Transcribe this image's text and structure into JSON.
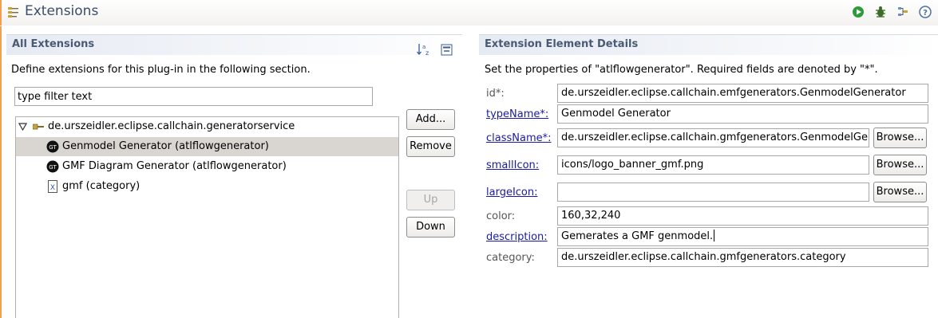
{
  "header": {
    "title": "Extensions",
    "icons": [
      "extensions-icon",
      "run-icon",
      "debug-icon",
      "extension-wizard-icon",
      "help-icon"
    ]
  },
  "left": {
    "title": "All Extensions",
    "description": "Define extensions for this plug-in in the following section.",
    "filter_placeholder": "type filter text",
    "tree": {
      "root": "de.urszeidler.eclipse.callchain.generatorservice",
      "children": [
        {
          "label": "Genmodel Generator (atlflowgenerator)",
          "icon": "generator-icon",
          "selected": true
        },
        {
          "label": "GMF Diagram Generator (atlflowgenerator)",
          "icon": "generator-icon",
          "selected": false
        },
        {
          "label": "gmf (category)",
          "icon": "category-icon",
          "selected": false
        }
      ]
    },
    "buttons": {
      "add": "Add...",
      "remove": "Remove",
      "up": "Up",
      "down": "Down"
    }
  },
  "right": {
    "title": "Extension Element Details",
    "description": "Set the properties of \"atlflowgenerator\". Required fields are denoted by \"*\".",
    "browse_label": "Browse...",
    "fields": {
      "id": {
        "label": "id*:",
        "value": "de.urszeidler.eclipse.callchain.emfgenerators.GenmodelGenerator"
      },
      "typeName": {
        "label": "typeName*:",
        "value": "Genmodel Generator"
      },
      "className": {
        "label": "className*:",
        "value": "de.urszeidler.eclipse.callchain.gmfgenerators.GenmodelGenerator"
      },
      "smallIcon": {
        "label": "smallIcon:",
        "value": "icons/logo_banner_gmf.png"
      },
      "largeIcon": {
        "label": "largeIcon:",
        "value": ""
      },
      "color": {
        "label": "color:",
        "value": "160,32,240"
      },
      "description": {
        "label": "description:",
        "value": "Gemerates a GMF genmodel."
      },
      "category": {
        "label": "category:",
        "value": "de.urszeidler.eclipse.callchain.gmfgenerators.category"
      }
    }
  }
}
